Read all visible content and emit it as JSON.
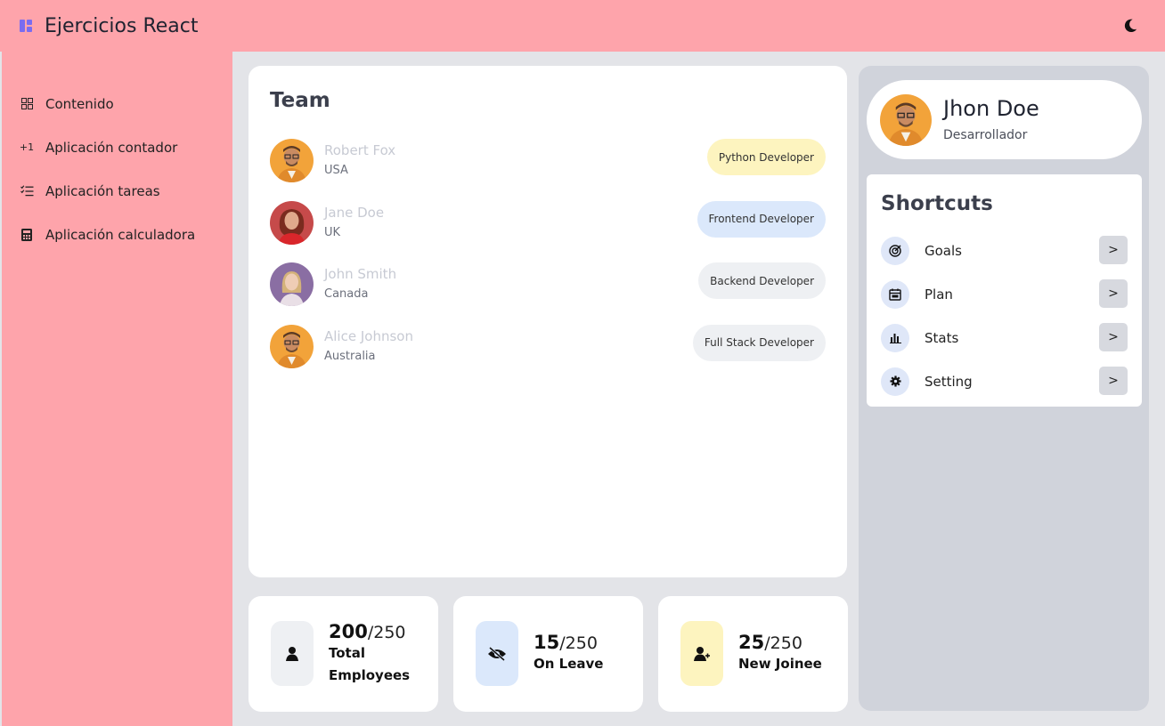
{
  "app": {
    "title": "Ejercicios React"
  },
  "colors": {
    "accent": "#fea4ab",
    "panel": "#d0d3db",
    "logo": "#7a6cf0"
  },
  "sidebar": {
    "items": [
      {
        "label": "Contenido",
        "icon": "grid-icon"
      },
      {
        "label": "Aplicación contador",
        "icon": "plus-one-icon",
        "glyph": "+1"
      },
      {
        "label": "Aplicación tareas",
        "icon": "checklist-icon"
      },
      {
        "label": "Aplicación calculadora",
        "icon": "calculator-icon"
      }
    ]
  },
  "team": {
    "title": "Team",
    "members": [
      {
        "name": "Robert Fox",
        "country": "USA",
        "role": "Python Developer",
        "role_color": "#fdf4bf"
      },
      {
        "name": "Jane Doe",
        "country": "UK",
        "role": "Frontend Developer",
        "role_color": "#dbe8fb"
      },
      {
        "name": "John Smith",
        "country": "Canada",
        "role": "Backend Developer",
        "role_color": "#eef0f3"
      },
      {
        "name": "Alice Johnson",
        "country": "Australia",
        "role": "Full Stack Developer",
        "role_color": "#eef0f3"
      }
    ]
  },
  "stats": [
    {
      "value": "200",
      "total": "/250",
      "label_line1": "Total",
      "label_line2": "Employees",
      "icon": "user-icon",
      "icon_bg": "#eef0f3"
    },
    {
      "value": "15",
      "total": "/250",
      "label_line1": "On Leave",
      "icon": "eye-slash-icon",
      "icon_bg": "#dbe8fb"
    },
    {
      "value": "25",
      "total": "/250",
      "label_line1": "New Joinee",
      "icon": "user-plus-icon",
      "icon_bg": "#fdf4bf"
    }
  ],
  "profile": {
    "name": "Jhon Doe",
    "role": "Desarrollador"
  },
  "shortcuts": {
    "title": "Shortcuts",
    "items": [
      {
        "label": "Goals",
        "icon": "target-icon"
      },
      {
        "label": "Plan",
        "icon": "calendar-icon"
      },
      {
        "label": "Stats",
        "icon": "bar-chart-icon"
      },
      {
        "label": "Setting",
        "icon": "gear-icon"
      }
    ],
    "button_glyph": ">"
  }
}
